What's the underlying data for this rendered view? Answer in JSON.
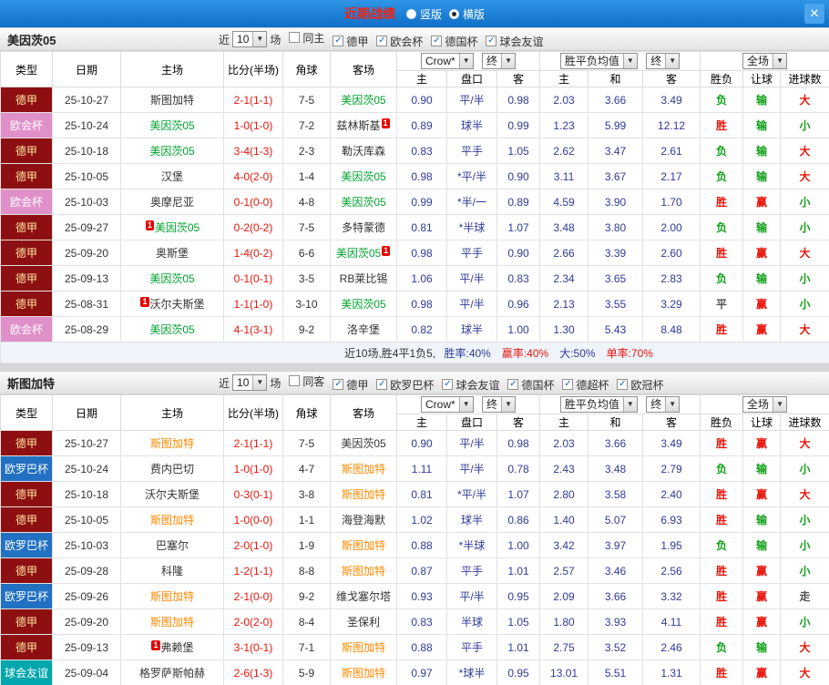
{
  "topbar": {
    "title": "近期战绩",
    "radios": [
      {
        "label": "竖版",
        "selected": false
      },
      {
        "label": "横版",
        "selected": true
      }
    ],
    "close_label": "✕"
  },
  "filters_common": {
    "near": "近",
    "count": "10",
    "games": "场"
  },
  "table_header": {
    "type": "类型",
    "date": "日期",
    "home": "主场",
    "score": "比分(半场)",
    "corner": "角球",
    "away": "客场",
    "odds_home": "主",
    "odds_handicap": "盘口",
    "odds_away": "客",
    "avg_home": "主",
    "avg_draw": "和",
    "avg_away": "客",
    "result": "胜负",
    "handicap_result": "让球",
    "goals": "进球数",
    "bookmaker_select": "Crow*",
    "final_select_1": "终",
    "avg_select": "胜平负均值",
    "final_select_2": "终",
    "scope_select": "全场"
  },
  "colors": {
    "win": "#e8160c",
    "loss": "#12a019",
    "draw": "#555555",
    "odds_text": "#2f3a97",
    "score_text": "#e8160c",
    "mainz_highlight": "#00a32e",
    "stuttgart_highlight": "#ff8a00",
    "bundesliga_bg": "#8d0f12",
    "conference_bg": "#e090c8",
    "europa_bg": "#2170c2",
    "friendly_bg": "#00a7ad",
    "title_red": "#ee2211",
    "topbar_blue": "#1170c8"
  },
  "sections": [
    {
      "team": "美因茨05",
      "filters": [
        {
          "label": "同主",
          "checked": false
        },
        {
          "label": "德甲",
          "checked": true
        },
        {
          "label": "欧会杯",
          "checked": true
        },
        {
          "label": "德国杯",
          "checked": true
        },
        {
          "label": "球会友谊",
          "checked": true
        }
      ],
      "rows": [
        {
          "league": {
            "label": "德甲",
            "key": "bundesliga"
          },
          "date": "25-10-27",
          "home": {
            "name": "斯图加特"
          },
          "score": "2-1(1-1)",
          "corner": "7-5",
          "away": {
            "name": "美因茨05",
            "hl": "green"
          },
          "odds": [
            "0.90",
            "平/半",
            "0.98"
          ],
          "avg": [
            "2.03",
            "3.66",
            "3.49"
          ],
          "result": {
            "t": "负",
            "c": "green"
          },
          "let": {
            "t": "输",
            "c": "green"
          },
          "goal": {
            "t": "大",
            "c": "red"
          }
        },
        {
          "league": {
            "label": "欧会杯",
            "key": "conference"
          },
          "date": "25-10-24",
          "home": {
            "name": "美因茨05",
            "hl": "green"
          },
          "score": "1-0(1-0)",
          "corner": "7-2",
          "away": {
            "name": "兹林斯基",
            "card": "after"
          },
          "odds": [
            "0.89",
            "球半",
            "0.99"
          ],
          "avg": [
            "1.23",
            "5.99",
            "12.12"
          ],
          "result": {
            "t": "胜",
            "c": "red"
          },
          "let": {
            "t": "输",
            "c": "green"
          },
          "goal": {
            "t": "小",
            "c": "green"
          }
        },
        {
          "league": {
            "label": "德甲",
            "key": "bundesliga"
          },
          "date": "25-10-18",
          "home": {
            "name": "美因茨05",
            "hl": "green"
          },
          "score": "3-4(1-3)",
          "corner": "2-3",
          "away": {
            "name": "勒沃库森"
          },
          "odds": [
            "0.83",
            "平手",
            "1.05"
          ],
          "avg": [
            "2.62",
            "3.47",
            "2.61"
          ],
          "result": {
            "t": "负",
            "c": "green"
          },
          "let": {
            "t": "输",
            "c": "green"
          },
          "goal": {
            "t": "大",
            "c": "red"
          }
        },
        {
          "league": {
            "label": "德甲",
            "key": "bundesliga"
          },
          "date": "25-10-05",
          "home": {
            "name": "汉堡"
          },
          "score": "4-0(2-0)",
          "corner": "1-4",
          "away": {
            "name": "美因茨05",
            "hl": "green"
          },
          "odds": [
            "0.98",
            "*平/半",
            "0.90"
          ],
          "avg": [
            "3.11",
            "3.67",
            "2.17"
          ],
          "result": {
            "t": "负",
            "c": "green"
          },
          "let": {
            "t": "输",
            "c": "green"
          },
          "goal": {
            "t": "大",
            "c": "red"
          }
        },
        {
          "league": {
            "label": "欧会杯",
            "key": "conference"
          },
          "date": "25-10-03",
          "home": {
            "name": "奥摩尼亚"
          },
          "score": "0-1(0-0)",
          "corner": "4-8",
          "away": {
            "name": "美因茨05",
            "hl": "green"
          },
          "odds": [
            "0.99",
            "*半/一",
            "0.89"
          ],
          "avg": [
            "4.59",
            "3.90",
            "1.70"
          ],
          "result": {
            "t": "胜",
            "c": "red"
          },
          "let": {
            "t": "赢",
            "c": "red"
          },
          "goal": {
            "t": "小",
            "c": "green"
          }
        },
        {
          "league": {
            "label": "德甲",
            "key": "bundesliga"
          },
          "date": "25-09-27",
          "home": {
            "name": "美因茨05",
            "hl": "green",
            "card": "before"
          },
          "score": "0-2(0-2)",
          "corner": "7-5",
          "away": {
            "name": "多特蒙德"
          },
          "odds": [
            "0.81",
            "*半球",
            "1.07"
          ],
          "avg": [
            "3.48",
            "3.80",
            "2.00"
          ],
          "result": {
            "t": "负",
            "c": "green"
          },
          "let": {
            "t": "输",
            "c": "green"
          },
          "goal": {
            "t": "小",
            "c": "green"
          }
        },
        {
          "league": {
            "label": "德甲",
            "key": "bundesliga"
          },
          "date": "25-09-20",
          "home": {
            "name": "奥斯堡"
          },
          "score": "1-4(0-2)",
          "corner": "6-6",
          "away": {
            "name": "美因茨05",
            "hl": "green",
            "card": "after"
          },
          "odds": [
            "0.98",
            "平手",
            "0.90"
          ],
          "avg": [
            "2.66",
            "3.39",
            "2.60"
          ],
          "result": {
            "t": "胜",
            "c": "red"
          },
          "let": {
            "t": "赢",
            "c": "red"
          },
          "goal": {
            "t": "大",
            "c": "red"
          }
        },
        {
          "league": {
            "label": "德甲",
            "key": "bundesliga"
          },
          "date": "25-09-13",
          "home": {
            "name": "美因茨05",
            "hl": "green"
          },
          "score": "0-1(0-1)",
          "corner": "3-5",
          "away": {
            "name": "RB莱比锡"
          },
          "odds": [
            "1.06",
            "平/半",
            "0.83"
          ],
          "avg": [
            "2.34",
            "3.65",
            "2.83"
          ],
          "result": {
            "t": "负",
            "c": "green"
          },
          "let": {
            "t": "输",
            "c": "green"
          },
          "goal": {
            "t": "小",
            "c": "green"
          }
        },
        {
          "league": {
            "label": "德甲",
            "key": "bundesliga"
          },
          "date": "25-08-31",
          "home": {
            "name": "沃尔夫斯堡",
            "card": "before"
          },
          "score": "1-1(1-0)",
          "corner": "3-10",
          "away": {
            "name": "美因茨05",
            "hl": "green"
          },
          "odds": [
            "0.98",
            "平/半",
            "0.96"
          ],
          "avg": [
            "2.13",
            "3.55",
            "3.29"
          ],
          "result": {
            "t": "平",
            "c": "dark"
          },
          "let": {
            "t": "赢",
            "c": "red"
          },
          "goal": {
            "t": "小",
            "c": "green"
          }
        },
        {
          "league": {
            "label": "欧会杯",
            "key": "conference"
          },
          "date": "25-08-29",
          "home": {
            "name": "美因茨05",
            "hl": "green"
          },
          "score": "4-1(3-1)",
          "corner": "9-2",
          "away": {
            "name": "洛辛堡"
          },
          "odds": [
            "0.82",
            "球半",
            "1.00"
          ],
          "avg": [
            "1.30",
            "5.43",
            "8.48"
          ],
          "result": {
            "t": "胜",
            "c": "red"
          },
          "let": {
            "t": "赢",
            "c": "red"
          },
          "goal": {
            "t": "大",
            "c": "red"
          }
        }
      ],
      "summary": {
        "prefix": "近10场,胜4平1负5, ",
        "stats": [
          {
            "text": "胜率:40%",
            "cls": "blue"
          },
          {
            "text": "赢率:40%",
            "cls": "red"
          },
          {
            "text": "大:50%",
            "cls": "blue"
          },
          {
            "text": "单率:70%",
            "cls": "red"
          }
        ]
      }
    },
    {
      "team": "斯图加特",
      "filters": [
        {
          "label": "同客",
          "checked": false
        },
        {
          "label": "德甲",
          "checked": true
        },
        {
          "label": "欧罗巴杯",
          "checked": true
        },
        {
          "label": "球会友谊",
          "checked": true
        },
        {
          "label": "德国杯",
          "checked": true
        },
        {
          "label": "德超杯",
          "checked": true
        },
        {
          "label": "欧冠杯",
          "checked": true
        }
      ],
      "rows": [
        {
          "league": {
            "label": "德甲",
            "key": "bundesliga"
          },
          "date": "25-10-27",
          "home": {
            "name": "斯图加特",
            "hl": "orange"
          },
          "score": "2-1(1-1)",
          "corner": "7-5",
          "away": {
            "name": "美因茨05"
          },
          "odds": [
            "0.90",
            "平/半",
            "0.98"
          ],
          "avg": [
            "2.03",
            "3.66",
            "3.49"
          ],
          "result": {
            "t": "胜",
            "c": "red"
          },
          "let": {
            "t": "赢",
            "c": "red"
          },
          "goal": {
            "t": "大",
            "c": "red"
          }
        },
        {
          "league": {
            "label": "欧罗巴杯",
            "key": "europa"
          },
          "date": "25-10-24",
          "home": {
            "name": "费内巴切"
          },
          "score": "1-0(1-0)",
          "corner": "4-7",
          "away": {
            "name": "斯图加特",
            "hl": "orange"
          },
          "odds": [
            "1.11",
            "平/半",
            "0.78"
          ],
          "avg": [
            "2.43",
            "3.48",
            "2.79"
          ],
          "result": {
            "t": "负",
            "c": "green"
          },
          "let": {
            "t": "输",
            "c": "green"
          },
          "goal": {
            "t": "小",
            "c": "green"
          }
        },
        {
          "league": {
            "label": "德甲",
            "key": "bundesliga"
          },
          "date": "25-10-18",
          "home": {
            "name": "沃尔夫斯堡"
          },
          "score": "0-3(0-1)",
          "corner": "3-8",
          "away": {
            "name": "斯图加特",
            "hl": "orange"
          },
          "odds": [
            "0.81",
            "*平/半",
            "1.07"
          ],
          "avg": [
            "2.80",
            "3.58",
            "2.40"
          ],
          "result": {
            "t": "胜",
            "c": "red"
          },
          "let": {
            "t": "赢",
            "c": "red"
          },
          "goal": {
            "t": "大",
            "c": "red"
          }
        },
        {
          "league": {
            "label": "德甲",
            "key": "bundesliga"
          },
          "date": "25-10-05",
          "home": {
            "name": "斯图加特",
            "hl": "orange"
          },
          "score": "1-0(0-0)",
          "corner": "1-1",
          "away": {
            "name": "海登海默"
          },
          "odds": [
            "1.02",
            "球半",
            "0.86"
          ],
          "avg": [
            "1.40",
            "5.07",
            "6.93"
          ],
          "result": {
            "t": "胜",
            "c": "red"
          },
          "let": {
            "t": "输",
            "c": "green"
          },
          "goal": {
            "t": "小",
            "c": "green"
          }
        },
        {
          "league": {
            "label": "欧罗巴杯",
            "key": "europa"
          },
          "date": "25-10-03",
          "home": {
            "name": "巴塞尔"
          },
          "score": "2-0(1-0)",
          "corner": "1-9",
          "away": {
            "name": "斯图加特",
            "hl": "orange"
          },
          "odds": [
            "0.88",
            "*半球",
            "1.00"
          ],
          "avg": [
            "3.42",
            "3.97",
            "1.95"
          ],
          "result": {
            "t": "负",
            "c": "green"
          },
          "let": {
            "t": "输",
            "c": "green"
          },
          "goal": {
            "t": "小",
            "c": "green"
          }
        },
        {
          "league": {
            "label": "德甲",
            "key": "bundesliga"
          },
          "date": "25-09-28",
          "home": {
            "name": "科隆"
          },
          "score": "1-2(1-1)",
          "corner": "8-8",
          "away": {
            "name": "斯图加特",
            "hl": "orange"
          },
          "odds": [
            "0.87",
            "平手",
            "1.01"
          ],
          "avg": [
            "2.57",
            "3.46",
            "2.56"
          ],
          "result": {
            "t": "胜",
            "c": "red"
          },
          "let": {
            "t": "赢",
            "c": "red"
          },
          "goal": {
            "t": "小",
            "c": "green"
          }
        },
        {
          "league": {
            "label": "欧罗巴杯",
            "key": "europa"
          },
          "date": "25-09-26",
          "home": {
            "name": "斯图加特",
            "hl": "orange"
          },
          "score": "2-1(0-0)",
          "corner": "9-2",
          "away": {
            "name": "维戈塞尔塔"
          },
          "odds": [
            "0.93",
            "平/半",
            "0.95"
          ],
          "avg": [
            "2.09",
            "3.66",
            "3.32"
          ],
          "result": {
            "t": "胜",
            "c": "red"
          },
          "let": {
            "t": "赢",
            "c": "red"
          },
          "goal": {
            "t": "走",
            "c": "dark"
          }
        },
        {
          "league": {
            "label": "德甲",
            "key": "bundesliga"
          },
          "date": "25-09-20",
          "home": {
            "name": "斯图加特",
            "hl": "orange"
          },
          "score": "2-0(2-0)",
          "corner": "8-4",
          "away": {
            "name": "圣保利"
          },
          "odds": [
            "0.83",
            "半球",
            "1.05"
          ],
          "avg": [
            "1.80",
            "3.93",
            "4.11"
          ],
          "result": {
            "t": "胜",
            "c": "red"
          },
          "let": {
            "t": "赢",
            "c": "red"
          },
          "goal": {
            "t": "小",
            "c": "green"
          }
        },
        {
          "league": {
            "label": "德甲",
            "key": "bundesliga"
          },
          "date": "25-09-13",
          "home": {
            "name": "弗赖堡",
            "card": "before"
          },
          "score": "3-1(0-1)",
          "corner": "7-1",
          "away": {
            "name": "斯图加特",
            "hl": "orange"
          },
          "odds": [
            "0.88",
            "平手",
            "1.01"
          ],
          "avg": [
            "2.75",
            "3.52",
            "2.46"
          ],
          "result": {
            "t": "负",
            "c": "green"
          },
          "let": {
            "t": "输",
            "c": "green"
          },
          "goal": {
            "t": "大",
            "c": "red"
          }
        },
        {
          "league": {
            "label": "球会友谊",
            "key": "friendly"
          },
          "date": "25-09-04",
          "home": {
            "name": "格罗萨斯帕赫"
          },
          "score": "2-6(1-3)",
          "corner": "5-9",
          "away": {
            "name": "斯图加特",
            "hl": "orange"
          },
          "odds": [
            "0.97",
            "*球半",
            "0.95"
          ],
          "avg": [
            "13.01",
            "5.51",
            "1.31"
          ],
          "result": {
            "t": "胜",
            "c": "red"
          },
          "let": {
            "t": "赢",
            "c": "red"
          },
          "goal": {
            "t": "大",
            "c": "red"
          }
        }
      ],
      "summary": null
    }
  ]
}
